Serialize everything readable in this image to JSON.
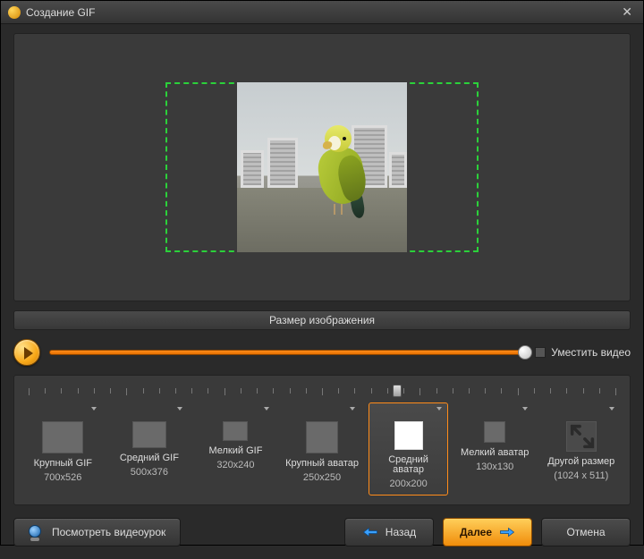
{
  "window": {
    "title": "Создание GIF"
  },
  "section": {
    "title": "Размер изображения"
  },
  "fit": {
    "label": "Уместить видео"
  },
  "presets": [
    {
      "label": "Крупный GIF",
      "dims": "700x526",
      "sw": 46,
      "sh": 36,
      "kind": "box"
    },
    {
      "label": "Средний GIF",
      "dims": "500x376",
      "sw": 38,
      "sh": 30,
      "kind": "box"
    },
    {
      "label": "Мелкий GIF",
      "dims": "320x240",
      "sw": 28,
      "sh": 22,
      "kind": "box"
    },
    {
      "label": "Крупный аватар",
      "dims": "250x250",
      "sw": 36,
      "sh": 36,
      "kind": "box"
    },
    {
      "label": "Средний аватар",
      "dims": "200x200",
      "sw": 32,
      "sh": 32,
      "kind": "box",
      "selected": true
    },
    {
      "label": "Мелкий аватар",
      "dims": "130x130",
      "sw": 24,
      "sh": 24,
      "kind": "box"
    },
    {
      "label": "Другой размер",
      "dims": "(1024 x 511)",
      "sw": 34,
      "sh": 34,
      "kind": "expand"
    }
  ],
  "buttons": {
    "tutorial": "Посмотреть видеоурок",
    "back": "Назад",
    "next": "Далее",
    "cancel": "Отмена"
  }
}
